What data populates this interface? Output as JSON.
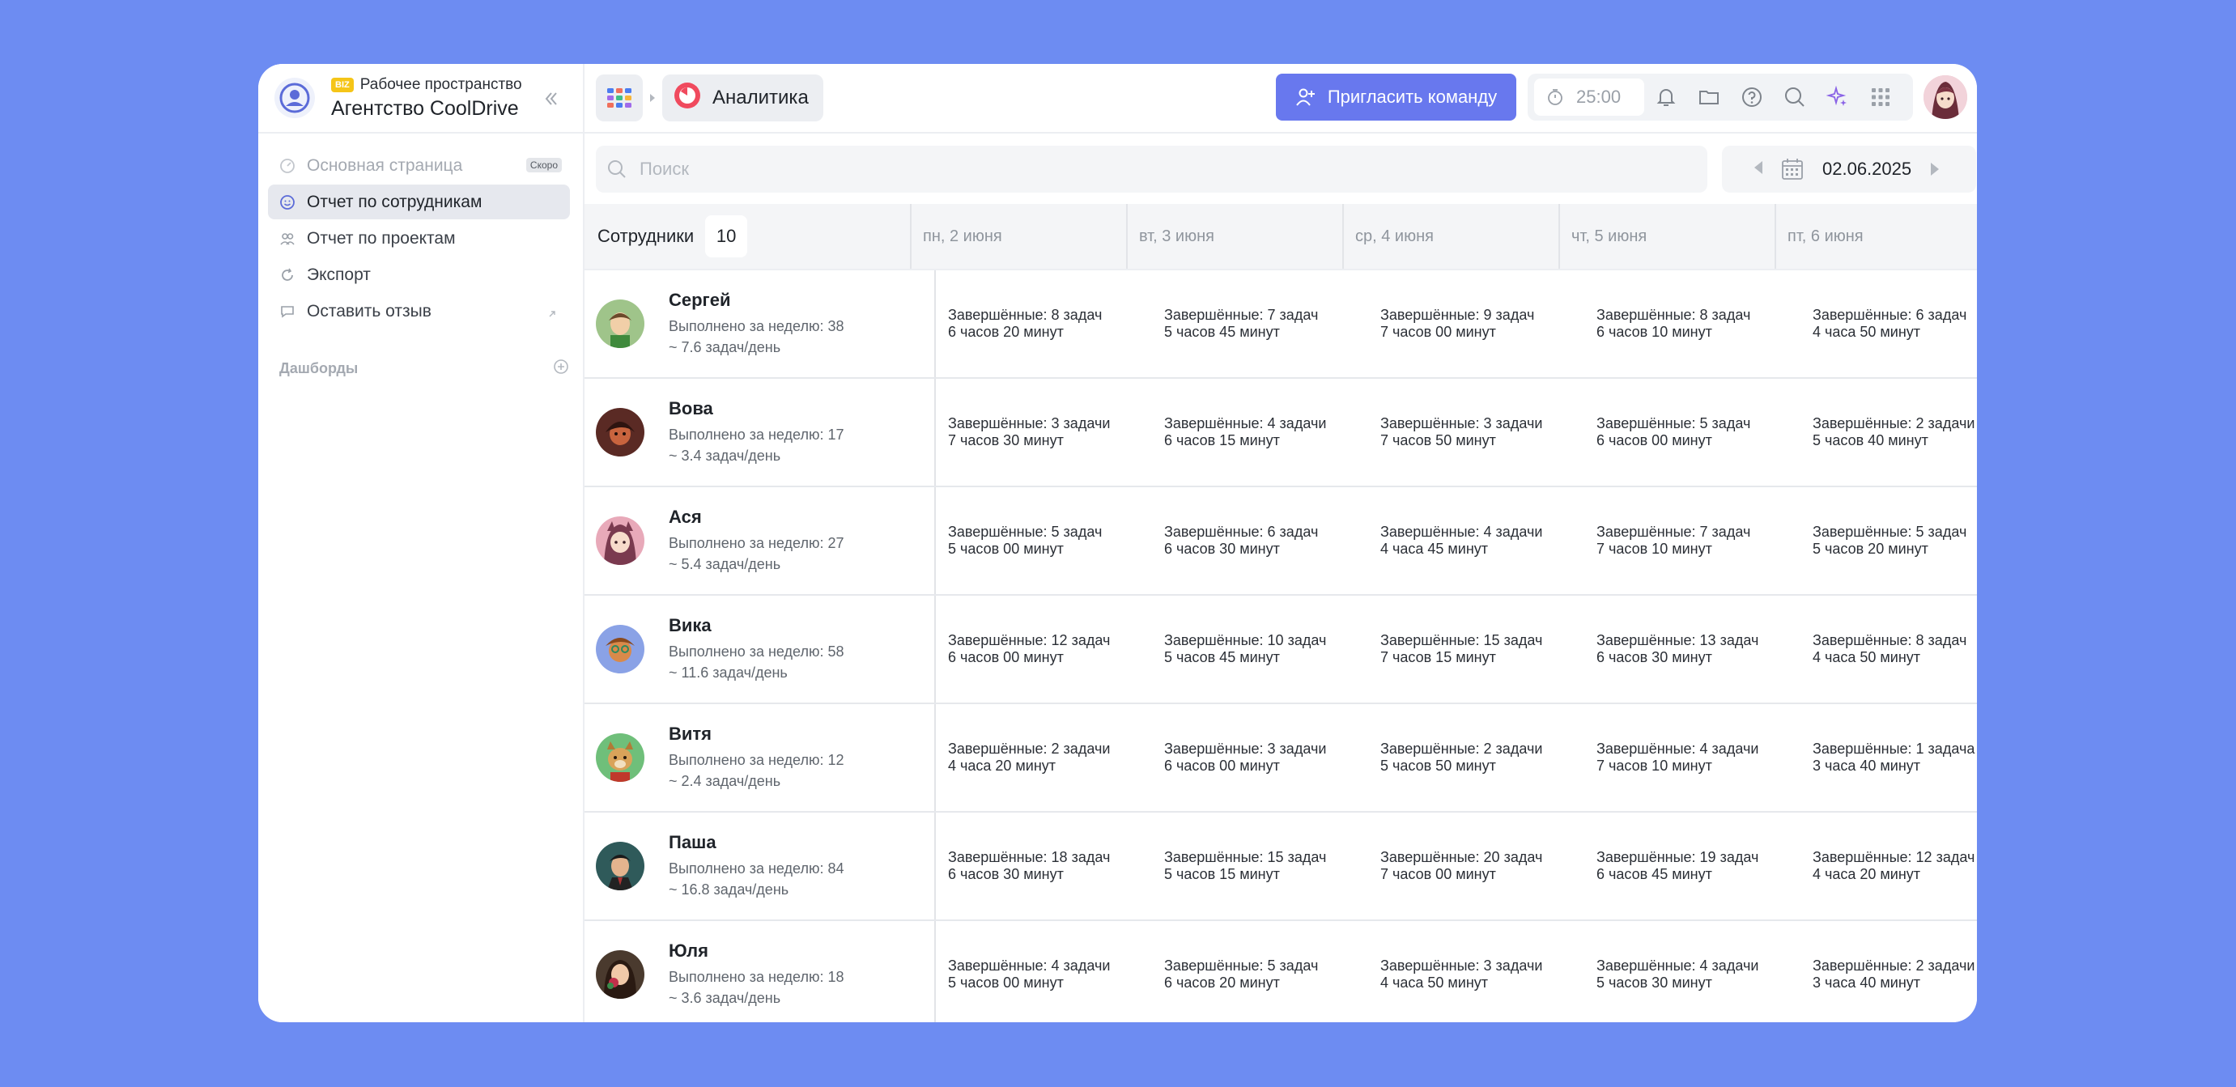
{
  "workspace": {
    "badge": "BIZ",
    "subtitle": "Рабочее пространство",
    "name": "Агентство CoolDrive"
  },
  "sidebar": {
    "items": [
      {
        "label": "Основная страница",
        "badge": "Скоро",
        "icon": "gauge-icon"
      },
      {
        "label": "Отчет по сотрудникам",
        "icon": "smile-icon"
      },
      {
        "label": "Отчет по проектам",
        "icon": "users-icon"
      },
      {
        "label": "Экспорт",
        "icon": "refresh-icon"
      },
      {
        "label": "Оставить отзыв",
        "icon": "chat-icon"
      }
    ],
    "dashboards_title": "Дашборды"
  },
  "topbar": {
    "breadcrumb": "Аналитика",
    "invite_label": "Пригласить команду",
    "timer": "25:00"
  },
  "search": {
    "placeholder": "Поиск"
  },
  "date": "02.06.2025",
  "table": {
    "employees_header": "Сотрудники",
    "employees_count": "10",
    "days": [
      "пн, 2 июня",
      "вт, 3 июня",
      "ср, 4 июня",
      "чт, 5 июня",
      "пт, 6 июня"
    ],
    "rows": [
      {
        "name": "Сергей",
        "week": "Выполнено за неделю: 38",
        "rate": "~ 7.6 задач/день",
        "cells": [
          [
            "Завершённые: 8 задач",
            "6 часов 20 минут"
          ],
          [
            "Завершённые: 7 задач",
            "5 часов 45 минут"
          ],
          [
            "Завершённые: 9 задач",
            "7 часов 00 минут"
          ],
          [
            "Завершённые: 8 задач",
            "6 часов 10 минут"
          ],
          [
            "Завершённые: 6 задач",
            "4 часа 50 минут"
          ]
        ]
      },
      {
        "name": "Вова",
        "week": "Выполнено за неделю: 17",
        "rate": "~ 3.4 задач/день",
        "cells": [
          [
            "Завершённые: 3 задачи",
            "7 часов 30 минут"
          ],
          [
            "Завершённые: 4 задачи",
            "6 часов 15 минут"
          ],
          [
            "Завершённые: 3 задачи",
            "7 часов 50 минут"
          ],
          [
            "Завершённые: 5 задач",
            "6 часов 00 минут"
          ],
          [
            "Завершённые: 2 задачи",
            "5 часов 40 минут"
          ]
        ]
      },
      {
        "name": "Ася",
        "week": "Выполнено за неделю: 27",
        "rate": "~ 5.4 задач/день",
        "cells": [
          [
            "Завершённые: 5 задач",
            "5 часов 00 минут"
          ],
          [
            "Завершённые: 6 задач",
            "6 часов 30 минут"
          ],
          [
            "Завершённые: 4 задачи",
            "4 часа 45 минут"
          ],
          [
            "Завершённые: 7 задач",
            "7 часов 10 минут"
          ],
          [
            "Завершённые: 5 задач",
            "5 часов 20 минут"
          ]
        ]
      },
      {
        "name": "Вика",
        "week": "Выполнено за неделю: 58",
        "rate": "~ 11.6 задач/день",
        "cells": [
          [
            "Завершённые: 12 задач",
            "6 часов 00 минут"
          ],
          [
            "Завершённые: 10 задач",
            "5 часов 45 минут"
          ],
          [
            "Завершённые: 15 задач",
            "7 часов 15 минут"
          ],
          [
            "Завершённые: 13 задач",
            "6 часов 30 минут"
          ],
          [
            "Завершённые: 8 задач",
            "4 часа 50 минут"
          ]
        ]
      },
      {
        "name": "Витя",
        "week": "Выполнено за неделю: 12",
        "rate": "~ 2.4 задач/день",
        "cells": [
          [
            "Завершённые: 2 задачи",
            "4 часа 20 минут"
          ],
          [
            "Завершённые: 3 задачи",
            "6 часов 00 минут"
          ],
          [
            "Завершённые: 2 задачи",
            "5 часов 50 минут"
          ],
          [
            "Завершённые: 4 задачи",
            "7 часов 10 минут"
          ],
          [
            "Завершённые: 1 задача",
            "3 часа 40 минут"
          ]
        ]
      },
      {
        "name": "Паша",
        "week": "Выполнено за неделю: 84",
        "rate": "~ 16.8 задач/день",
        "cells": [
          [
            "Завершённые: 18 задач",
            "6 часов 30 минут"
          ],
          [
            "Завершённые: 15 задач",
            "5 часов 15 минут"
          ],
          [
            "Завершённые: 20 задач",
            "7 часов 00 минут"
          ],
          [
            "Завершённые: 19 задач",
            "6 часов 45 минут"
          ],
          [
            "Завершённые: 12 задач",
            "4 часа 20 минут"
          ]
        ]
      },
      {
        "name": "Юля",
        "week": "Выполнено за неделю: 18",
        "rate": "~ 3.6 задач/день",
        "cells": [
          [
            "Завершённые: 4 задачи",
            "5 часов 00 минут"
          ],
          [
            "Завершённые: 5 задач",
            "6 часов 20 минут"
          ],
          [
            "Завершённые: 3 задачи",
            "4 часа 50 минут"
          ],
          [
            "Завершённые: 4 задачи",
            "5 часов 30 минут"
          ],
          [
            "Завершённые: 2 задачи",
            "3 часа 40 минут"
          ]
        ]
      }
    ]
  },
  "colors": {
    "background": "#6d8cf2",
    "accent": "#6878ee",
    "active_nav": "#e6e8ee"
  }
}
